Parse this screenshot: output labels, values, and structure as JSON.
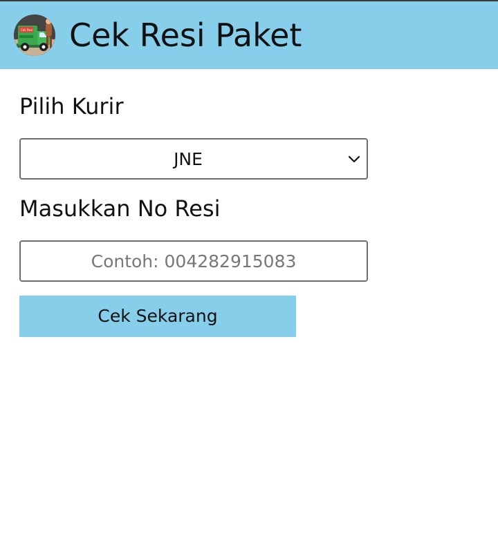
{
  "header": {
    "title": "Cek Resi Paket",
    "logo_icon": "delivery-truck-logo-icon",
    "logo_badge_text": "Cek Resi",
    "background_color": "#87ceeb"
  },
  "form": {
    "courier_label": "Pilih Kurir",
    "courier_selected": "JNE",
    "resi_label": "Masukkan No Resi",
    "resi_placeholder": "Contoh: 004282915083",
    "submit_label": "Cek Sekarang"
  },
  "icons": {
    "dropdown": "chevron-down-icon"
  },
  "colors": {
    "accent": "#87ceeb"
  }
}
